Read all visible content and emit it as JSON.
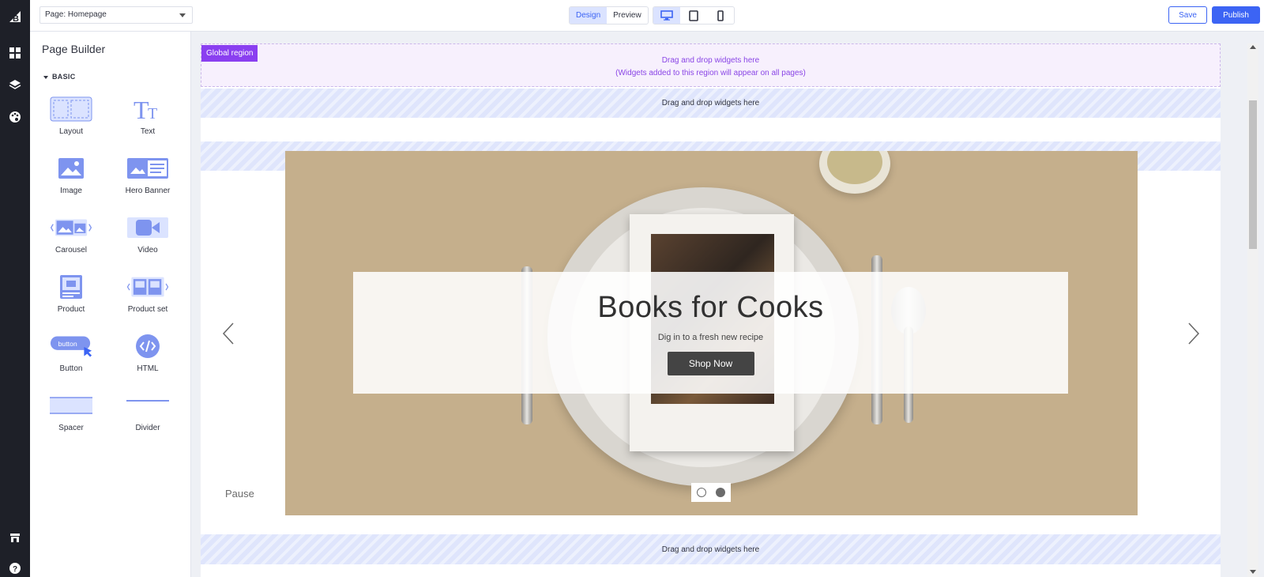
{
  "app": {
    "logo": "B"
  },
  "rail": {
    "icons": [
      "widgets-icon",
      "layers-icon",
      "theme-palette-icon",
      "storefront-icon",
      "help-icon"
    ]
  },
  "topbar": {
    "page_select": "Page: Homepage",
    "mode_tabs": [
      {
        "label": "Design",
        "active": true
      },
      {
        "label": "Preview",
        "active": false
      }
    ],
    "devices": [
      {
        "name": "desktop",
        "active": true
      },
      {
        "name": "tablet",
        "active": false
      },
      {
        "name": "mobile",
        "active": false
      }
    ],
    "save_label": "Save",
    "publish_label": "Publish"
  },
  "sidebar": {
    "title": "Page Builder",
    "section": "BASIC",
    "widgets": [
      {
        "label": "Layout"
      },
      {
        "label": "Text"
      },
      {
        "label": "Image"
      },
      {
        "label": "Hero Banner"
      },
      {
        "label": "Carousel"
      },
      {
        "label": "Video"
      },
      {
        "label": "Product"
      },
      {
        "label": "Product set"
      },
      {
        "label": "Button",
        "icon_text": "button"
      },
      {
        "label": "HTML"
      },
      {
        "label": "Spacer"
      },
      {
        "label": "Divider"
      }
    ]
  },
  "canvas": {
    "global_region": {
      "tag": "Global region",
      "line1": "Drag and drop widgets here",
      "line2": "(Widgets added to this region will appear on all pages)"
    },
    "drop_zones": [
      "Drag and drop widgets here",
      "Drag and drop widgets here"
    ],
    "carousel": {
      "heading": "Books for Cooks",
      "subheading": "Dig in to a fresh new recipe",
      "button": "Shop Now",
      "pause": "Pause",
      "slides": 2,
      "active_slide": 2
    }
  },
  "colors": {
    "accent": "#3c64f4",
    "global_purple": "#8a3ff0",
    "hero_bg": "#c5af8c",
    "rail_bg": "#1e2028"
  }
}
